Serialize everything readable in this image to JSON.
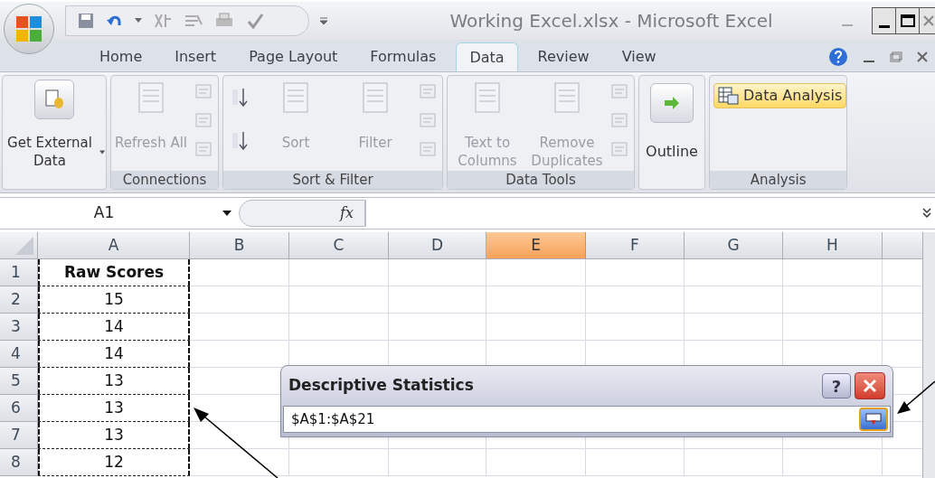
{
  "window": {
    "title": "Working Excel.xlsx - Microsoft Excel"
  },
  "tabs": [
    {
      "label": "Home",
      "selected": false
    },
    {
      "label": "Insert",
      "selected": false
    },
    {
      "label": "Page Layout",
      "selected": false
    },
    {
      "label": "Formulas",
      "selected": false
    },
    {
      "label": "Data",
      "selected": true
    },
    {
      "label": "Review",
      "selected": false
    },
    {
      "label": "View",
      "selected": false
    }
  ],
  "ribbon": {
    "groups": [
      {
        "label": "Connections",
        "pre": {
          "label": "Get External Data",
          "disabled": false
        },
        "items": [
          {
            "kind": "large",
            "label": "Refresh All",
            "disabled": true
          },
          {
            "kind": "stack",
            "disabled": true
          }
        ]
      },
      {
        "label": "Sort & Filter",
        "items": [
          {
            "kind": "sortstack",
            "disabled": false
          },
          {
            "kind": "large",
            "label": "Sort",
            "disabled": true
          },
          {
            "kind": "large",
            "label": "Filter",
            "disabled": true
          },
          {
            "kind": "stack",
            "disabled": true
          }
        ]
      },
      {
        "label": "Data Tools",
        "items": [
          {
            "kind": "large",
            "label": "Text to Columns",
            "disabled": true
          },
          {
            "kind": "large",
            "label": "Remove Duplicates",
            "disabled": true
          },
          {
            "kind": "stack",
            "disabled": true
          }
        ]
      },
      {
        "items": [
          {
            "kind": "outline",
            "label": "Outline",
            "disabled": false
          }
        ]
      },
      {
        "label": "Analysis",
        "items": [
          {
            "kind": "highlight",
            "label": "Data Analysis",
            "disabled": false
          }
        ]
      }
    ]
  },
  "name_box": "A1",
  "function_symbol": "fx",
  "columns": [
    {
      "label": "A",
      "selected": false
    },
    {
      "label": "B",
      "selected": false
    },
    {
      "label": "C",
      "selected": false
    },
    {
      "label": "D",
      "selected": false
    },
    {
      "label": "E",
      "selected": true
    },
    {
      "label": "F",
      "selected": false
    },
    {
      "label": "G",
      "selected": false
    },
    {
      "label": "H",
      "selected": false
    }
  ],
  "rows": [
    {
      "number": "1",
      "value": "Raw Scores"
    },
    {
      "number": "2",
      "value": "15"
    },
    {
      "number": "3",
      "value": "14"
    },
    {
      "number": "4",
      "value": "14"
    },
    {
      "number": "5",
      "value": "13"
    },
    {
      "number": "6",
      "value": "13"
    },
    {
      "number": "7",
      "value": "13"
    },
    {
      "number": "8",
      "value": "12"
    }
  ],
  "dialog": {
    "title": "Descriptive Statistics",
    "help_label": "?",
    "value": "$A$1:$A$21"
  }
}
